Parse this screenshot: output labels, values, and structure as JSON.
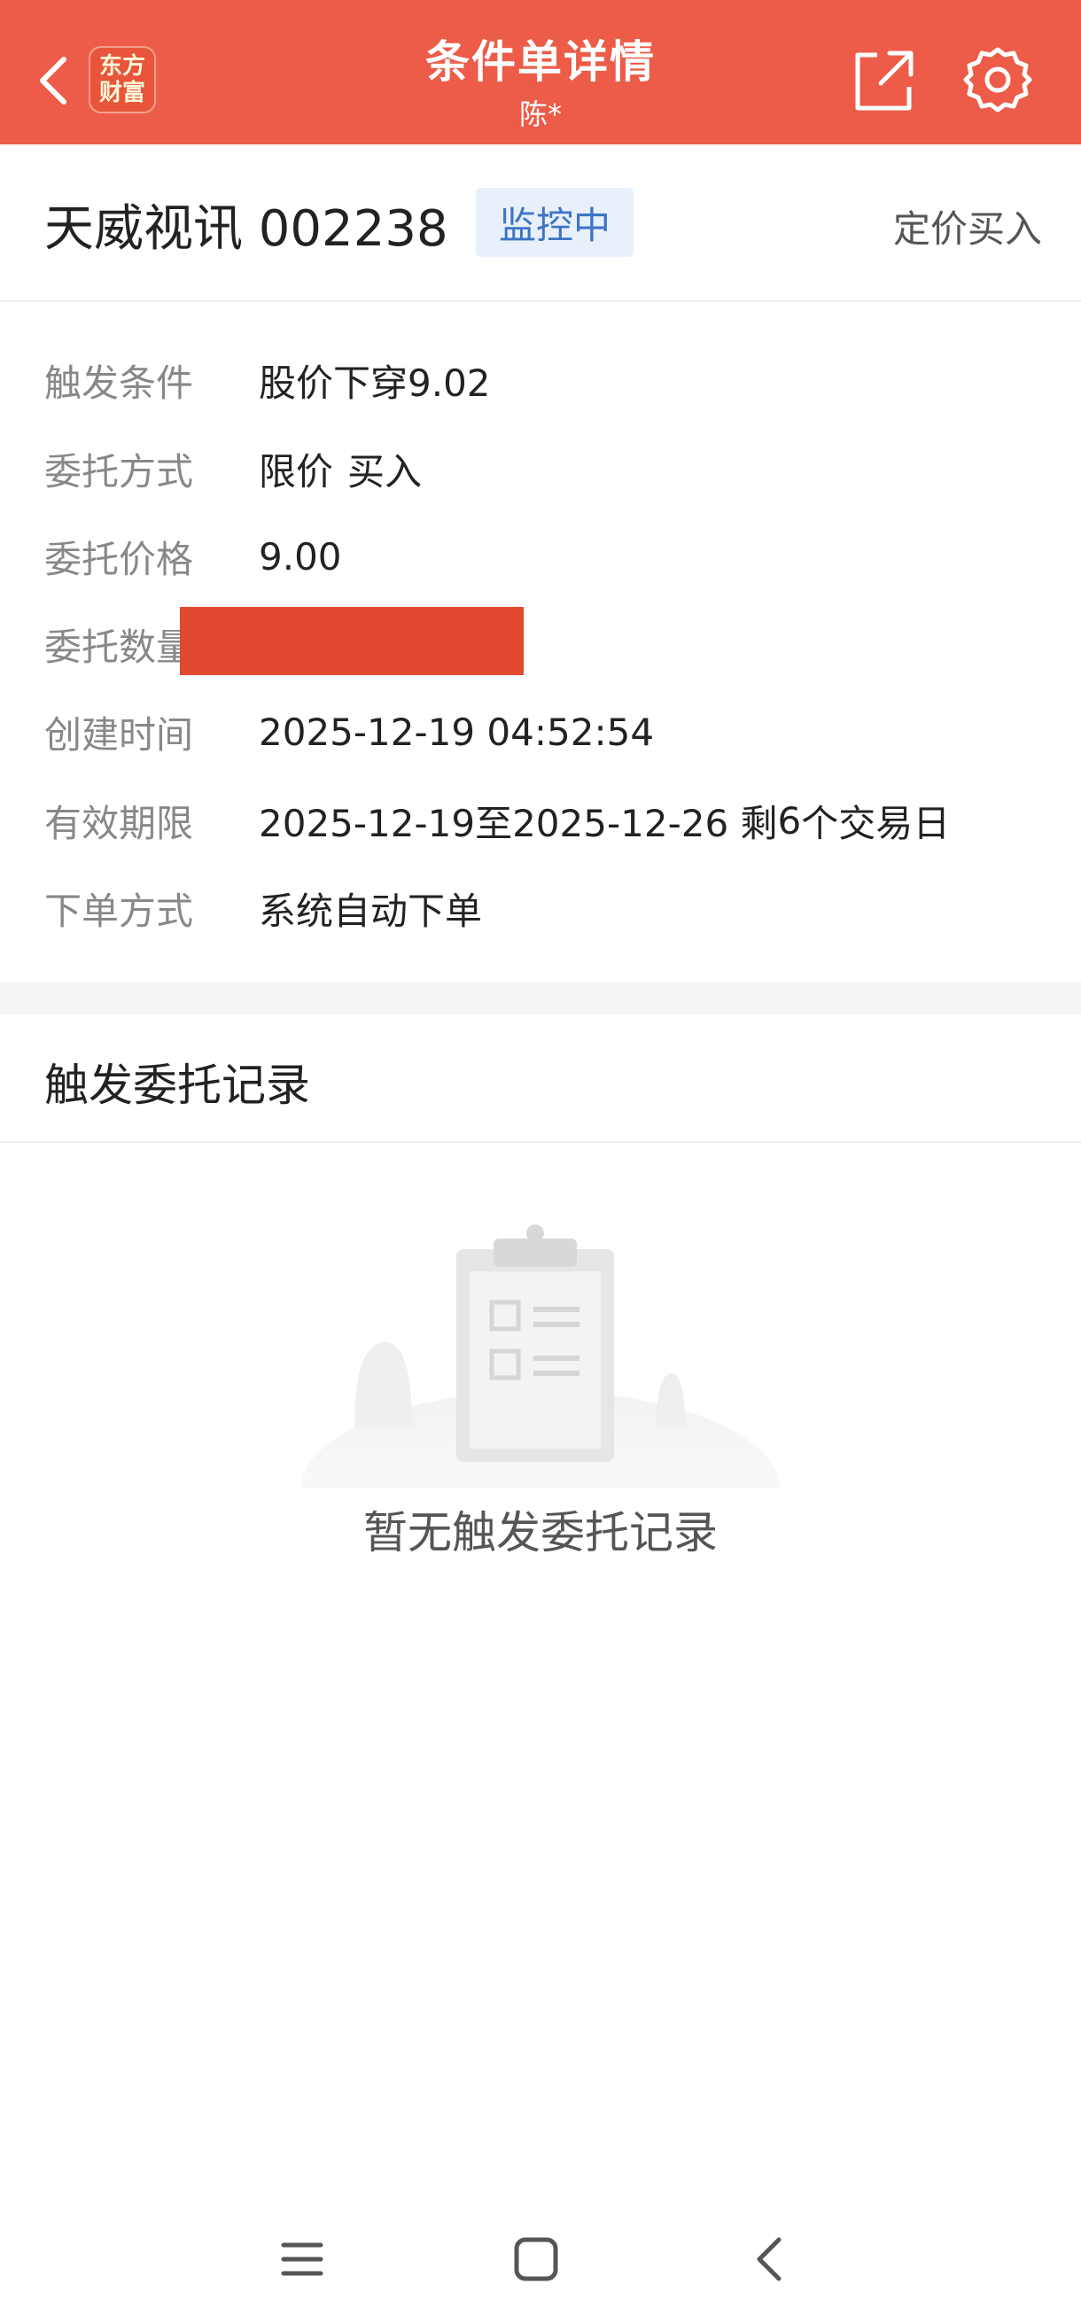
{
  "header": {
    "back_icon": "chevron-left-icon",
    "logo_line1": "东方",
    "logo_line2": "财富",
    "title": "条件单详情",
    "subtitle": "陈*",
    "share_icon": "share-icon",
    "settings_icon": "gear-icon"
  },
  "stock": {
    "name": "天威视讯 002238",
    "status": "监控中",
    "order_type": "定价买入"
  },
  "details": {
    "trigger_label": "触发条件",
    "trigger_value": "股价下穿9.02",
    "method_label": "委托方式",
    "method_value": "限价",
    "method_side": "买入",
    "price_label": "委托价格",
    "price_value": "9.00",
    "qty_label": "委托数量",
    "created_label": "创建时间",
    "created_value": "2025-12-19 04:52:54",
    "valid_label": "有效期限",
    "valid_range": "2025-12-19至2025-12-26 剩",
    "valid_days": "6",
    "valid_suffix": "个交易日",
    "place_label": "下单方式",
    "place_value": "系统自动下单"
  },
  "records": {
    "title": "触发委托记录",
    "empty_text": "暂无触发委托记录"
  },
  "colors": {
    "header_bg": "#ec5c48",
    "accent_red": "#e0443a",
    "badge_blue": "#3e74c6"
  }
}
